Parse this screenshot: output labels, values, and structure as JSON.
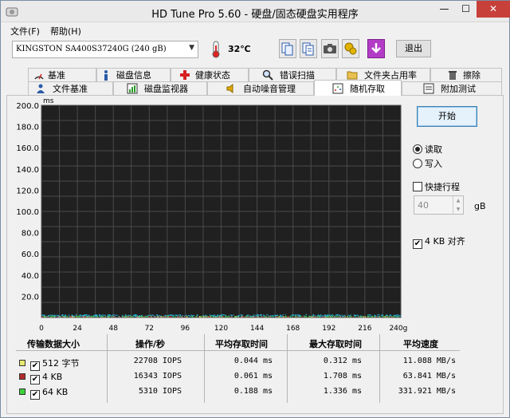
{
  "window": {
    "title": "HD Tune Pro 5.60 - 硬盘/固态硬盘实用程序",
    "min_glyph": "—",
    "max_glyph": "☐",
    "close_glyph": "✕"
  },
  "menu": {
    "file": "文件(F)",
    "help": "帮助(H)"
  },
  "toolbar": {
    "drive": "KINGSTON SA400S37240G (240 gB)",
    "temperature": "32℃",
    "exit_label": "退出",
    "icons": [
      "copy-info-icon",
      "copy-text-icon",
      "camera-icon",
      "options-icon",
      "save-download-icon"
    ]
  },
  "tabs_top": [
    {
      "label": "基准",
      "icon": "benchmark-icon"
    },
    {
      "label": "磁盘信息",
      "icon": "info-icon"
    },
    {
      "label": "健康状态",
      "icon": "health-icon"
    },
    {
      "label": "错误扫描",
      "icon": "magnifier-icon"
    },
    {
      "label": "文件夹占用率",
      "icon": "folder-icon"
    },
    {
      "label": "擦除",
      "icon": "trash-icon"
    }
  ],
  "tabs_bottom": [
    {
      "label": "文件基准",
      "icon": "file-benchmark-icon"
    },
    {
      "label": "磁盘监视器",
      "icon": "monitor-icon"
    },
    {
      "label": "自动噪音管理",
      "icon": "speaker-icon"
    },
    {
      "label": "随机存取",
      "icon": "random-access-icon",
      "active": true
    },
    {
      "label": "附加测试",
      "icon": "extra-tests-icon"
    }
  ],
  "controls": {
    "start_label": "开始",
    "read_label": "读取",
    "write_label": "写入",
    "read_selected": true,
    "short_stroke_label": "快捷行程",
    "short_stroke_checked": false,
    "short_stroke_value": "40",
    "short_stroke_unit": "gB",
    "align_label": "4 KB 对齐",
    "align_checked": true
  },
  "chart_data": {
    "type": "scatter",
    "ylabel": "ms",
    "xlabel_unit": "gB",
    "ylim": [
      0,
      200
    ],
    "xlim": [
      0,
      240
    ],
    "y_ticks": [
      "200.0",
      "180.0",
      "160.0",
      "140.0",
      "120.0",
      "100.0",
      "80.0",
      "60.0",
      "40.0",
      "20.0"
    ],
    "x_ticks": [
      "0",
      "24",
      "48",
      "72",
      "96",
      "120",
      "144",
      "168",
      "192",
      "216",
      "240gB"
    ],
    "grid": true,
    "background": "#202020",
    "series": [
      {
        "name": "512 字节",
        "color": "#e8e870",
        "y_mean": 0.044
      },
      {
        "name": "4 KB",
        "color": "#b52a2a",
        "y_mean": 0.061
      },
      {
        "name": "64 KB",
        "color": "#3bd23b",
        "y_mean": 0.188
      },
      {
        "color": "#29b6d8",
        "y_mean": 1.0
      }
    ]
  },
  "results": {
    "headers": [
      "传输数据大小",
      "操作/秒",
      "平均存取时间",
      "最大存取时间",
      "平均速度"
    ],
    "rows": [
      {
        "label": "512 字节",
        "color": "#e8e870",
        "checked": true,
        "ops": "22708 IOPS",
        "avg": "0.044 ms",
        "max": "0.312 ms",
        "speed": "11.088 MB/s"
      },
      {
        "label": "4 KB",
        "color": "#b52a2a",
        "checked": true,
        "ops": "16343 IOPS",
        "avg": "0.061 ms",
        "max": "1.708 ms",
        "speed": "63.841 MB/s"
      },
      {
        "label": "64 KB",
        "color": "#3bd23b",
        "checked": true,
        "ops": "5310 IOPS",
        "avg": "0.188 ms",
        "max": "1.336 ms",
        "speed": "331.921 MB/s"
      }
    ]
  }
}
